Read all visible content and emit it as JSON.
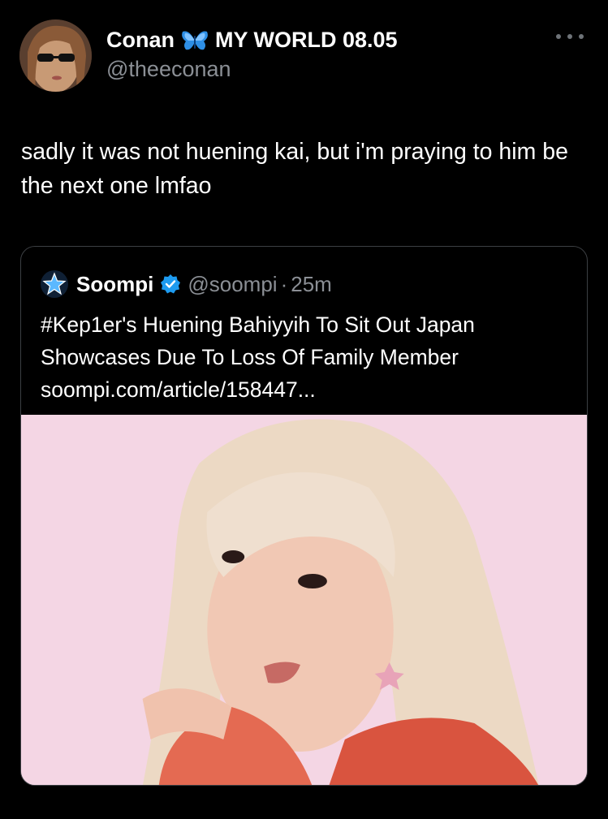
{
  "tweet": {
    "author_name": "Conan",
    "author_status": "MY WORLD 08.05",
    "author_handle": "@theeconan",
    "text": "sadly it was not huening kai, but i'm praying to him be the next one lmfao"
  },
  "quoted": {
    "name": "Soompi",
    "handle": "@soompi",
    "separator": "·",
    "time": "25m",
    "text_line1": "#Kep1er's Huening Bahiyyih To Sit Out Japan",
    "text_line2": "Showcases Due To Loss Of Family Member",
    "link": "soompi.com/article/158447..."
  },
  "colors": {
    "background": "#000000",
    "text": "#ffffff",
    "secondary": "#8b8f95",
    "border": "#3c3f43",
    "verified": "#1d9bf0",
    "photo_bg": "#f4d6e4"
  },
  "icons": [
    "butterfly-emoji-icon",
    "more-icon",
    "soompi-star-icon",
    "verified-badge-icon"
  ]
}
